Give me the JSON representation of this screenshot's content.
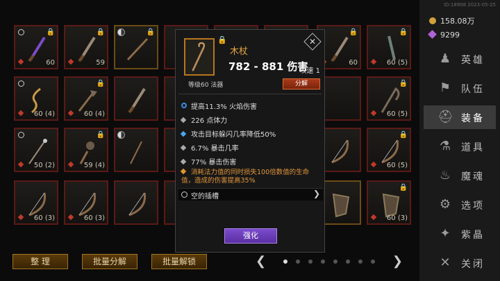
{
  "inventory": {
    "slots": [
      {
        "level": "60",
        "lock": true,
        "mark": "ring",
        "frame": "red",
        "weapon": "dagger-purple"
      },
      {
        "level": "59",
        "lock": true,
        "mark": "",
        "frame": "red",
        "weapon": "dagger"
      },
      {
        "level": "",
        "lock": true,
        "mark": "yy",
        "frame": "gold",
        "weapon": "sword"
      },
      {
        "level": "",
        "lock": false,
        "mark": "",
        "frame": "red",
        "weapon": ""
      },
      {
        "level": "",
        "lock": false,
        "mark": "",
        "frame": "red",
        "weapon": ""
      },
      {
        "level": "",
        "lock": false,
        "mark": "",
        "frame": "red",
        "weapon": ""
      },
      {
        "level": "60",
        "lock": true,
        "mark": "",
        "frame": "red",
        "weapon": "dagger"
      },
      {
        "level": "60 (5)",
        "lock": true,
        "mark": "",
        "frame": "red",
        "weapon": "knife"
      },
      {
        "level": "60 (4)",
        "lock": false,
        "mark": "ring",
        "frame": "red",
        "weapon": "whip"
      },
      {
        "level": "60 (4)",
        "lock": true,
        "mark": "",
        "frame": "red",
        "weapon": "axe"
      },
      {
        "level": "",
        "lock": false,
        "mark": "",
        "frame": "red",
        "weapon": "dagger"
      },
      {
        "level": "",
        "lock": false,
        "mark": "",
        "frame": "red",
        "weapon": ""
      },
      {
        "level": "",
        "lock": false,
        "mark": "",
        "frame": "red",
        "weapon": ""
      },
      {
        "level": "",
        "lock": false,
        "mark": "",
        "frame": "red",
        "weapon": ""
      },
      {
        "level": "",
        "lock": false,
        "mark": "",
        "frame": "red",
        "weapon": ""
      },
      {
        "level": "60 (5)",
        "lock": true,
        "mark": "",
        "frame": "red",
        "weapon": "scythe"
      },
      {
        "level": "50 (2)",
        "lock": false,
        "mark": "ring",
        "frame": "red",
        "weapon": "staff"
      },
      {
        "level": "59 (4)",
        "lock": true,
        "mark": "",
        "frame": "red",
        "weapon": "flail"
      },
      {
        "level": "",
        "lock": false,
        "mark": "yy",
        "frame": "red",
        "weapon": "wand"
      },
      {
        "level": "",
        "lock": false,
        "mark": "",
        "frame": "red",
        "weapon": ""
      },
      {
        "level": "",
        "lock": false,
        "mark": "",
        "frame": "red",
        "weapon": ""
      },
      {
        "level": "",
        "lock": false,
        "mark": "",
        "frame": "red",
        "weapon": ""
      },
      {
        "level": "",
        "lock": false,
        "mark": "",
        "frame": "red",
        "weapon": "bow"
      },
      {
        "level": "60 (5)",
        "lock": true,
        "mark": "",
        "frame": "red",
        "weapon": "bow"
      },
      {
        "level": "60 (3)",
        "lock": false,
        "mark": "",
        "frame": "red",
        "weapon": "bow"
      },
      {
        "level": "60 (3)",
        "lock": false,
        "mark": "",
        "frame": "red",
        "weapon": "bow"
      },
      {
        "level": "",
        "lock": false,
        "mark": "",
        "frame": "red",
        "weapon": "bow"
      },
      {
        "level": "",
        "lock": false,
        "mark": "",
        "frame": "red",
        "weapon": ""
      },
      {
        "level": "",
        "lock": false,
        "mark": "",
        "frame": "red",
        "weapon": ""
      },
      {
        "level": "",
        "lock": false,
        "mark": "",
        "frame": "red",
        "weapon": ""
      },
      {
        "level": "",
        "lock": false,
        "mark": "",
        "frame": "gold",
        "weapon": "shield"
      },
      {
        "level": "60 (3)",
        "lock": true,
        "mark": "",
        "frame": "red",
        "weapon": "shield"
      }
    ]
  },
  "bottom": {
    "sort_label": "整 理",
    "batch_dismantle_label": "批量分解",
    "batch_unlock_label": "批量解锁",
    "page_dots": 8,
    "active_dot": 0
  },
  "sidebar": {
    "stamp": "ID:18908  2023-05-25",
    "gold": "158.08万",
    "gems": "9299",
    "items": [
      {
        "label": "英雄",
        "icon": "hero-icon",
        "glyph": "♟"
      },
      {
        "label": "队伍",
        "icon": "flag-icon",
        "glyph": "⚑"
      },
      {
        "label": "装备",
        "icon": "helmet-icon",
        "glyph": "⛑"
      },
      {
        "label": "道具",
        "icon": "potion-icon",
        "glyph": "⚗"
      },
      {
        "label": "魔魂",
        "icon": "flame-icon",
        "glyph": "♨"
      },
      {
        "label": "选项",
        "icon": "gear-icon",
        "glyph": "⚙"
      },
      {
        "label": "紫晶",
        "icon": "crystal-icon",
        "glyph": "✦"
      },
      {
        "label": "关闭",
        "icon": "close-icon",
        "glyph": "✕"
      }
    ],
    "active_index": 2
  },
  "tooltip": {
    "name": "木杖",
    "damage": "782 - 881 伤害",
    "attack_speed": "攻速 1",
    "class_line": "等级60 法器",
    "dismantle_label": "分解",
    "stats": [
      {
        "text": "提高11.3% 火焰伤害",
        "bullet": "ring"
      },
      {
        "text": "226 点体力",
        "bullet": "grey"
      },
      {
        "text": "攻击目标躲闪几率降低50%",
        "bullet": "blue"
      },
      {
        "text": "6.7% 暴击几率",
        "bullet": "grey"
      },
      {
        "text": "77% 暴击伤害",
        "bullet": "grey"
      }
    ],
    "legendary": "消耗法力值的同时损失100倍数值的生命值，造成的伤害提高35%",
    "socket_label": "空的插槽",
    "enhance_label": "强化"
  },
  "colors": {
    "accent_orange": "#e6a443",
    "enhance_purple": "#7b4bcc",
    "frame_red": "#5b1a16"
  }
}
